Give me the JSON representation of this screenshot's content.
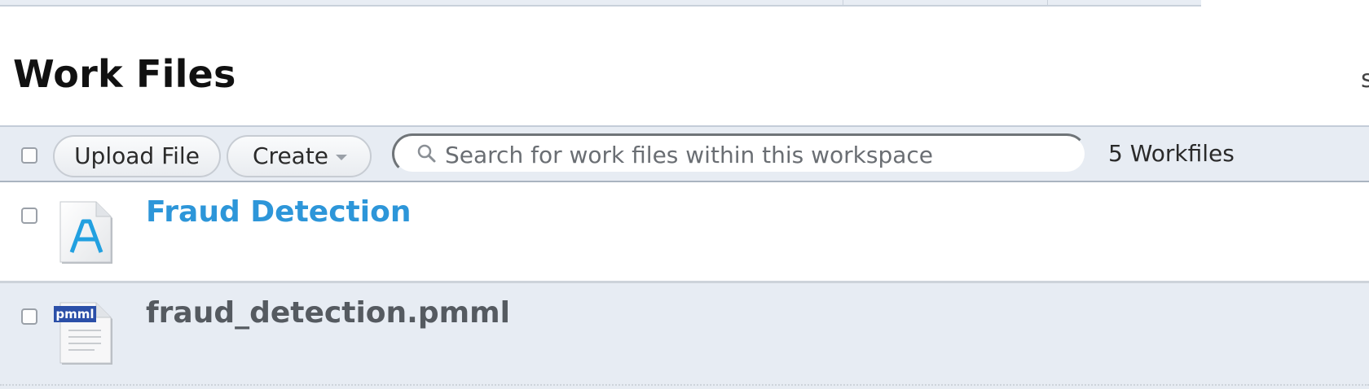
{
  "page": {
    "title": "Work Files",
    "edge_text": "s"
  },
  "toolbar": {
    "upload_label": "Upload File",
    "create_label": "Create",
    "search_placeholder": "Search for work files within this workspace",
    "count_label": "5 Workfiles"
  },
  "files": [
    {
      "name": "Fraud Detection",
      "icon": "alpine-workflow-icon",
      "link_color": "#2d96d9"
    },
    {
      "name": "fraud_detection.pmml",
      "icon": "pmml-file-icon",
      "badge": "pmml"
    }
  ],
  "colors": {
    "toolbar_bg": "#e7ecf3",
    "link": "#2d96d9",
    "selected_row_bg": "#e7ecf3"
  }
}
